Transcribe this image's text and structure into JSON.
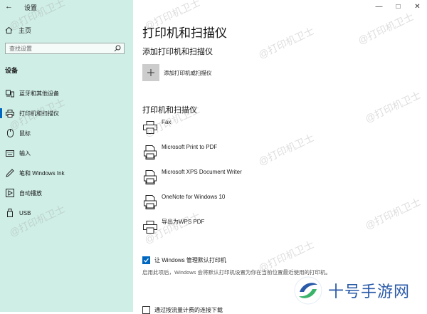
{
  "window": {
    "title": "设置",
    "back_glyph": "←"
  },
  "sidebar": {
    "home_label": "主页",
    "search_placeholder": "查找设置",
    "section_label": "设备",
    "items": [
      {
        "label": "蓝牙和其他设备",
        "icon": "bluetooth-devices-icon"
      },
      {
        "label": "打印机和扫描仪",
        "icon": "printer-icon",
        "selected": true
      },
      {
        "label": "鼠标",
        "icon": "mouse-icon"
      },
      {
        "label": "输入",
        "icon": "keyboard-icon"
      },
      {
        "label": "笔和 Windows Ink",
        "icon": "pen-icon"
      },
      {
        "label": "自动播放",
        "icon": "autoplay-icon"
      },
      {
        "label": "USB",
        "icon": "usb-icon"
      }
    ]
  },
  "main": {
    "title": "打印机和扫描仪",
    "add_section": {
      "heading": "添加打印机和扫描仪",
      "add_label": "添加打印机或扫描仪"
    },
    "list_section": {
      "heading": "打印机和扫描仪",
      "printers": [
        {
          "name": "Fax",
          "icon": "fax-printer-icon"
        },
        {
          "name": "Microsoft Print to PDF",
          "icon": "pdf-printer-icon"
        },
        {
          "name": "Microsoft XPS Document Writer",
          "icon": "xps-printer-icon"
        },
        {
          "name": "OneNote for Windows 10",
          "icon": "onenote-printer-icon"
        },
        {
          "name": "导出为WPS PDF",
          "icon": "wps-printer-icon"
        }
      ]
    },
    "default_printer": {
      "label": "让 Windows 管理默认打印机",
      "checked": true,
      "description": "启用此项后，Windows 会将默认打印机设置为你在当前位置最近使用的打印机。"
    },
    "metered": {
      "label": "通过按流量计费的连接下载",
      "checked": false
    }
  },
  "watermark": {
    "text": "@打印机卫士",
    "brand": "十号手游网"
  },
  "colors": {
    "sidebar_bg": "#cfeee6",
    "accent": "#0067c0",
    "brand": "#2a5aa8"
  }
}
